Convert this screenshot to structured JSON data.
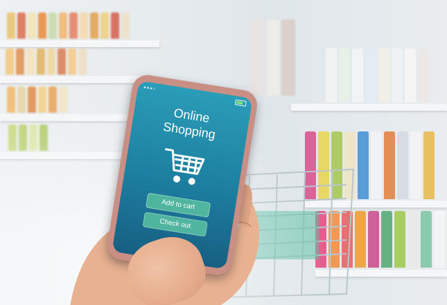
{
  "phone": {
    "title_line1": "Online",
    "title_line2": "Shopping",
    "add_to_cart_label": "Add to cart",
    "check_out_label": "Check out"
  },
  "icons": {
    "cart": "shopping-cart-icon",
    "battery": "battery-icon"
  },
  "colors": {
    "screen_top": "#2a9db8",
    "screen_bottom": "#175f82",
    "button": "#4fb59e",
    "phone_body": "#c98f85"
  }
}
